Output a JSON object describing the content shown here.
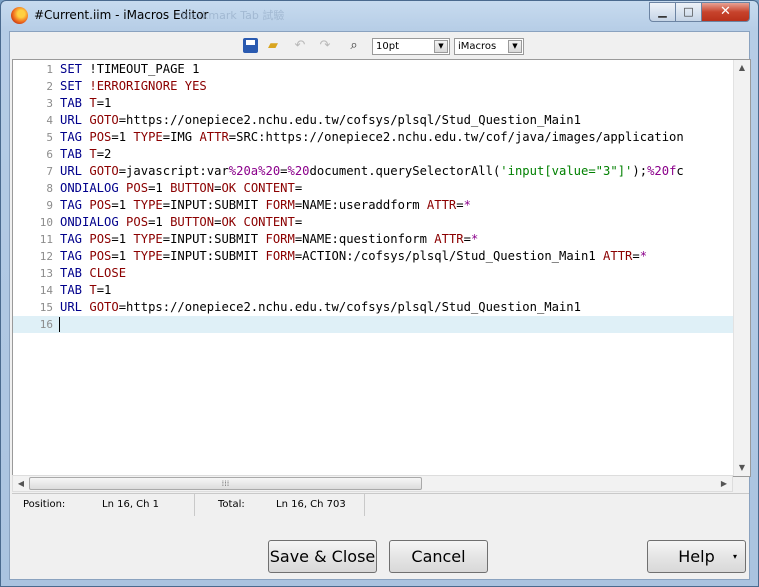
{
  "window": {
    "title": "#Current.iim - iMacros Editor",
    "ghost_title": "Bookmark Tab 試驗"
  },
  "title_controls": {
    "minimize": "▁",
    "maximize": "□",
    "close": "✕"
  },
  "toolbar": {
    "font_size": "10pt",
    "syntax": "iMacros",
    "icons": [
      "save-icon",
      "open-icon",
      "undo-icon",
      "redo-icon",
      "find-icon"
    ]
  },
  "editor": {
    "lines": [
      {
        "n": "1",
        "parts": [
          [
            "k",
            "SET"
          ],
          [
            "v",
            " !TIMEOUT_PAGE 1"
          ]
        ]
      },
      {
        "n": "2",
        "parts": [
          [
            "k",
            "SET"
          ],
          [
            "p",
            " !ERRORIGNORE"
          ],
          [
            "p",
            " YES"
          ]
        ]
      },
      {
        "n": "3",
        "parts": [
          [
            "k",
            "TAB"
          ],
          [
            "v",
            " "
          ],
          [
            "p",
            "T"
          ],
          [
            "v",
            "=1"
          ]
        ]
      },
      {
        "n": "4",
        "parts": [
          [
            "k",
            "URL"
          ],
          [
            "v",
            " "
          ],
          [
            "p",
            "GOTO"
          ],
          [
            "v",
            "=https://onepiece2.nchu.edu.tw/cofsys/plsql/Stud_Question_Main1"
          ]
        ]
      },
      {
        "n": "5",
        "parts": [
          [
            "k",
            "TAG"
          ],
          [
            "v",
            " "
          ],
          [
            "p",
            "POS"
          ],
          [
            "v",
            "=1 "
          ],
          [
            "p",
            "TYPE"
          ],
          [
            "v",
            "=IMG "
          ],
          [
            "p",
            "ATTR"
          ],
          [
            "v",
            "=SRC:https://onepiece2.nchu.edu.tw/cof/java/images/application"
          ]
        ]
      },
      {
        "n": "6",
        "parts": [
          [
            "k",
            "TAB"
          ],
          [
            "v",
            " "
          ],
          [
            "p",
            "T"
          ],
          [
            "v",
            "=2"
          ]
        ]
      },
      {
        "n": "7",
        "parts": [
          [
            "k",
            "URL"
          ],
          [
            "v",
            " "
          ],
          [
            "p",
            "GOTO"
          ],
          [
            "v",
            "=javascript:var"
          ],
          [
            "m",
            "%20a"
          ],
          [
            "m",
            "%20"
          ],
          [
            "v",
            "="
          ],
          [
            "m",
            "%20"
          ],
          [
            "v",
            "document.querySelectorAll("
          ],
          [
            "s",
            "'input[value=\"3\"]'"
          ],
          [
            "v",
            ");"
          ],
          [
            "m",
            "%20f"
          ],
          [
            "v",
            "c"
          ]
        ]
      },
      {
        "n": "8",
        "parts": [
          [
            "k",
            "ONDIALOG"
          ],
          [
            "v",
            " "
          ],
          [
            "p",
            "POS"
          ],
          [
            "v",
            "=1 "
          ],
          [
            "p",
            "BUTTON"
          ],
          [
            "v",
            "="
          ],
          [
            "p",
            "OK"
          ],
          [
            "v",
            " "
          ],
          [
            "p",
            "CONTENT"
          ],
          [
            "v",
            "="
          ]
        ]
      },
      {
        "n": "9",
        "parts": [
          [
            "k",
            "TAG"
          ],
          [
            "v",
            " "
          ],
          [
            "p",
            "POS"
          ],
          [
            "v",
            "=1 "
          ],
          [
            "p",
            "TYPE"
          ],
          [
            "v",
            "=INPUT:SUBMIT "
          ],
          [
            "p",
            "FORM"
          ],
          [
            "v",
            "=NAME:useraddform "
          ],
          [
            "p",
            "ATTR"
          ],
          [
            "v",
            "="
          ],
          [
            "m",
            "*"
          ]
        ]
      },
      {
        "n": "10",
        "parts": [
          [
            "k",
            "ONDIALOG"
          ],
          [
            "v",
            " "
          ],
          [
            "p",
            "POS"
          ],
          [
            "v",
            "=1 "
          ],
          [
            "p",
            "BUTTON"
          ],
          [
            "v",
            "="
          ],
          [
            "p",
            "OK"
          ],
          [
            "v",
            " "
          ],
          [
            "p",
            "CONTENT"
          ],
          [
            "v",
            "="
          ]
        ]
      },
      {
        "n": "11",
        "parts": [
          [
            "k",
            "TAG"
          ],
          [
            "v",
            " "
          ],
          [
            "p",
            "POS"
          ],
          [
            "v",
            "=1 "
          ],
          [
            "p",
            "TYPE"
          ],
          [
            "v",
            "=INPUT:SUBMIT "
          ],
          [
            "p",
            "FORM"
          ],
          [
            "v",
            "=NAME:questionform "
          ],
          [
            "p",
            "ATTR"
          ],
          [
            "v",
            "="
          ],
          [
            "m",
            "*"
          ]
        ]
      },
      {
        "n": "12",
        "parts": [
          [
            "k",
            "TAG"
          ],
          [
            "v",
            " "
          ],
          [
            "p",
            "POS"
          ],
          [
            "v",
            "=1 "
          ],
          [
            "p",
            "TYPE"
          ],
          [
            "v",
            "=INPUT:SUBMIT "
          ],
          [
            "p",
            "FORM"
          ],
          [
            "v",
            "=ACTION:/cofsys/plsql/Stud_Question_Main1 "
          ],
          [
            "p",
            "ATTR"
          ],
          [
            "v",
            "="
          ],
          [
            "m",
            "*"
          ]
        ]
      },
      {
        "n": "13",
        "parts": [
          [
            "k",
            "TAB"
          ],
          [
            "v",
            " "
          ],
          [
            "p",
            "CLOSE"
          ]
        ]
      },
      {
        "n": "14",
        "parts": [
          [
            "k",
            "TAB"
          ],
          [
            "v",
            " "
          ],
          [
            "p",
            "T"
          ],
          [
            "v",
            "=1"
          ]
        ]
      },
      {
        "n": "15",
        "parts": [
          [
            "k",
            "URL"
          ],
          [
            "v",
            " "
          ],
          [
            "p",
            "GOTO"
          ],
          [
            "v",
            "=https://onepiece2.nchu.edu.tw/cofsys/plsql/Stud_Question_Main1"
          ]
        ]
      },
      {
        "n": "16",
        "parts": []
      }
    ],
    "active_line": 16
  },
  "status": {
    "position_label": "Position:",
    "position_value": "Ln 16, Ch 1",
    "total_label": "Total:",
    "total_value": "Ln 16, Ch 703"
  },
  "buttons": {
    "save_close": "Save & Close",
    "cancel": "Cancel",
    "help": "Help",
    "help_arrow": "▾"
  }
}
